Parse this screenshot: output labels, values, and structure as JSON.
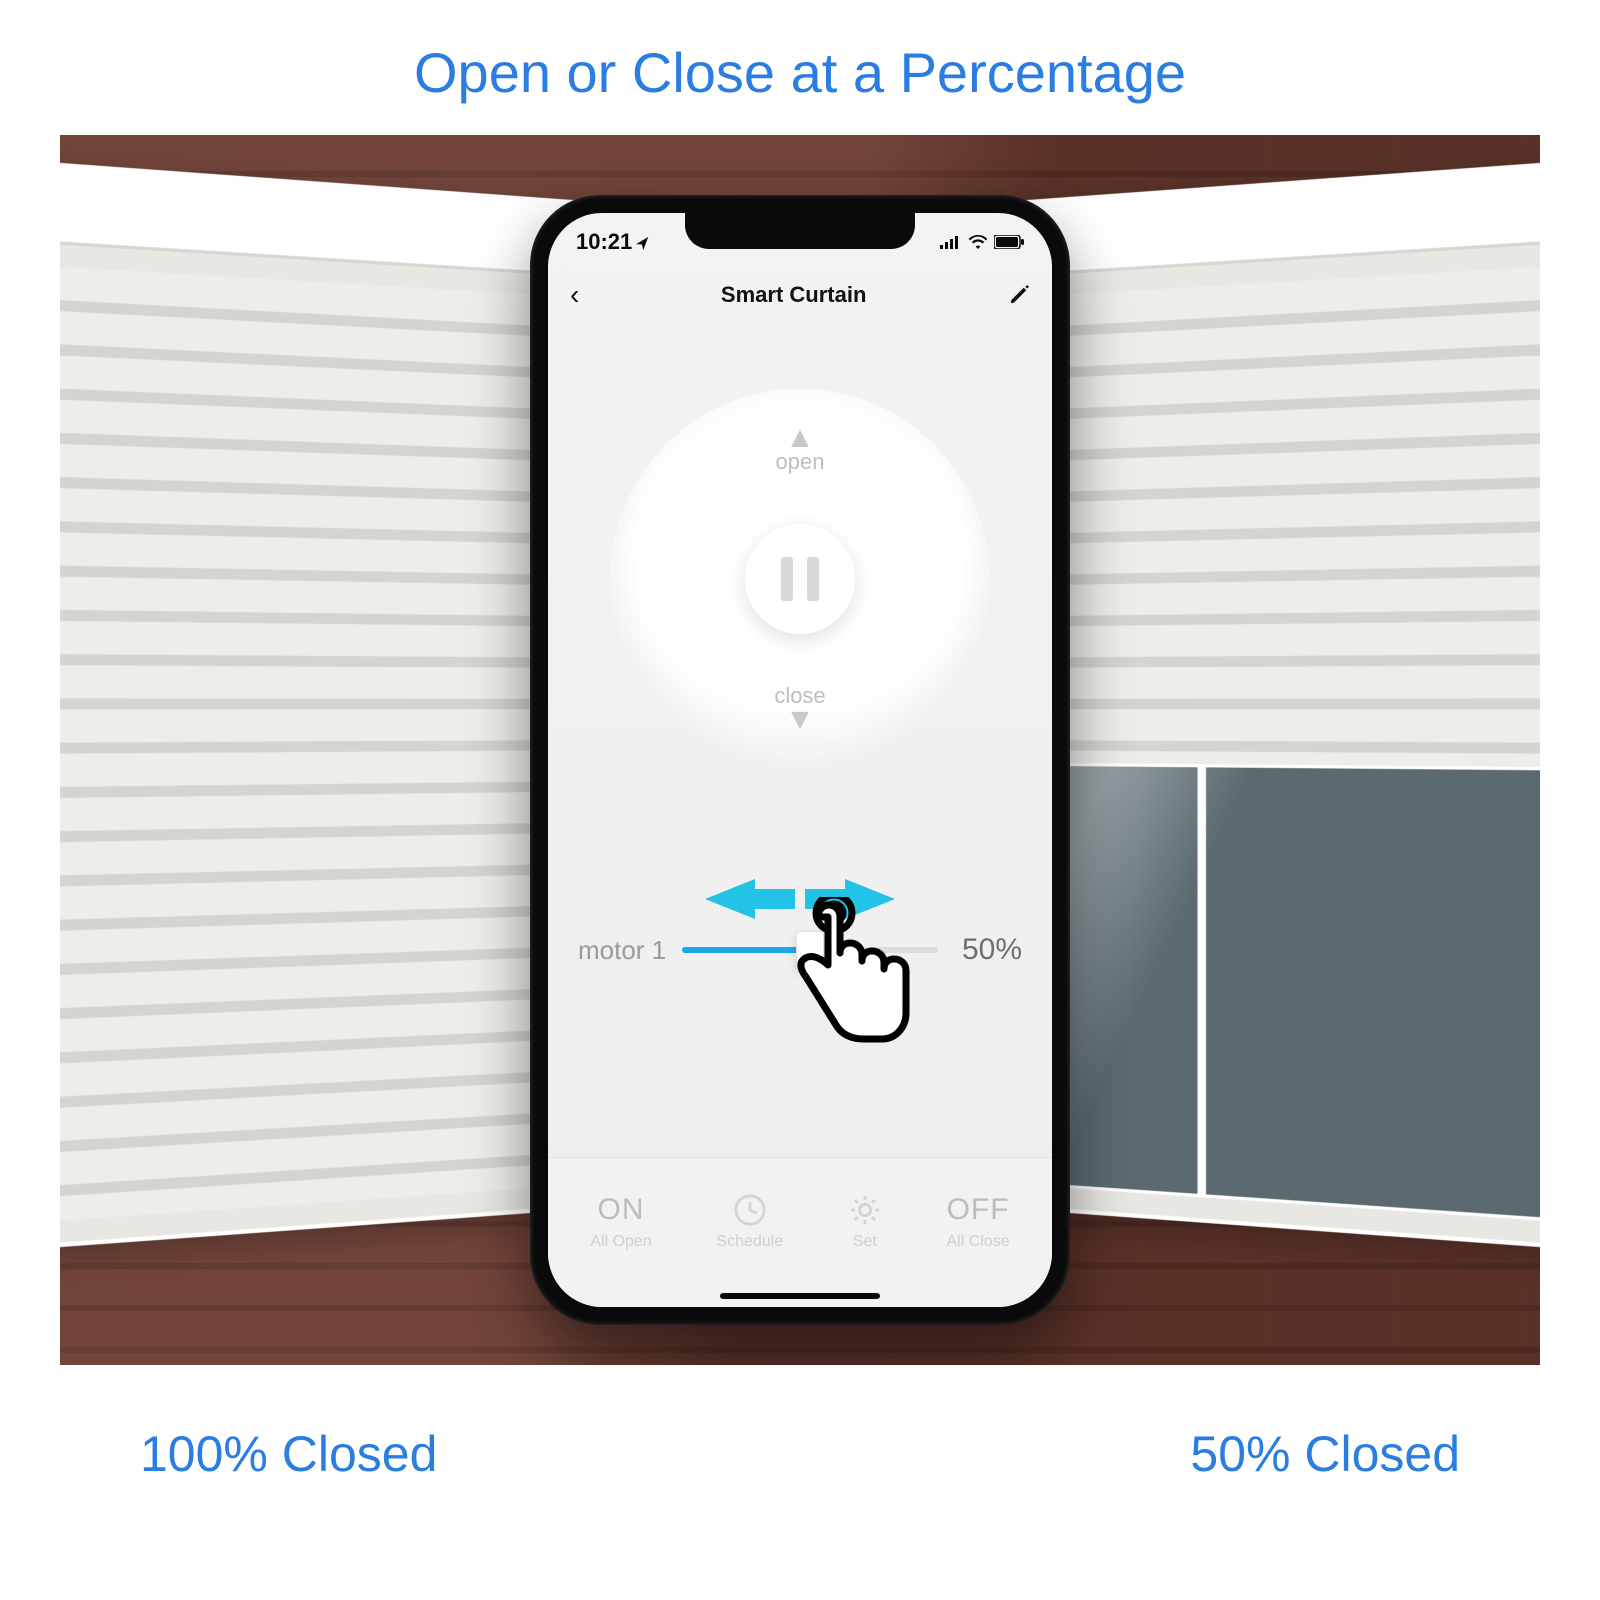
{
  "heading": "Open or Close at a Percentage",
  "footer": {
    "left": "100% Closed",
    "right": "50% Closed"
  },
  "phone": {
    "status": {
      "time": "10:21",
      "location_icon": "location-icon"
    },
    "nav": {
      "title": "Smart Curtain"
    },
    "dial": {
      "open_label": "open",
      "close_label": "close"
    },
    "slider": {
      "motor_label": "motor 1",
      "percent_label": "50%",
      "percent_value": 50
    },
    "bottom": {
      "all_open_big": "ON",
      "all_open_sub": "All Open",
      "schedule_sub": "Schedule",
      "set_sub": "Set",
      "all_close_big": "OFF",
      "all_close_sub": "All Close"
    }
  }
}
